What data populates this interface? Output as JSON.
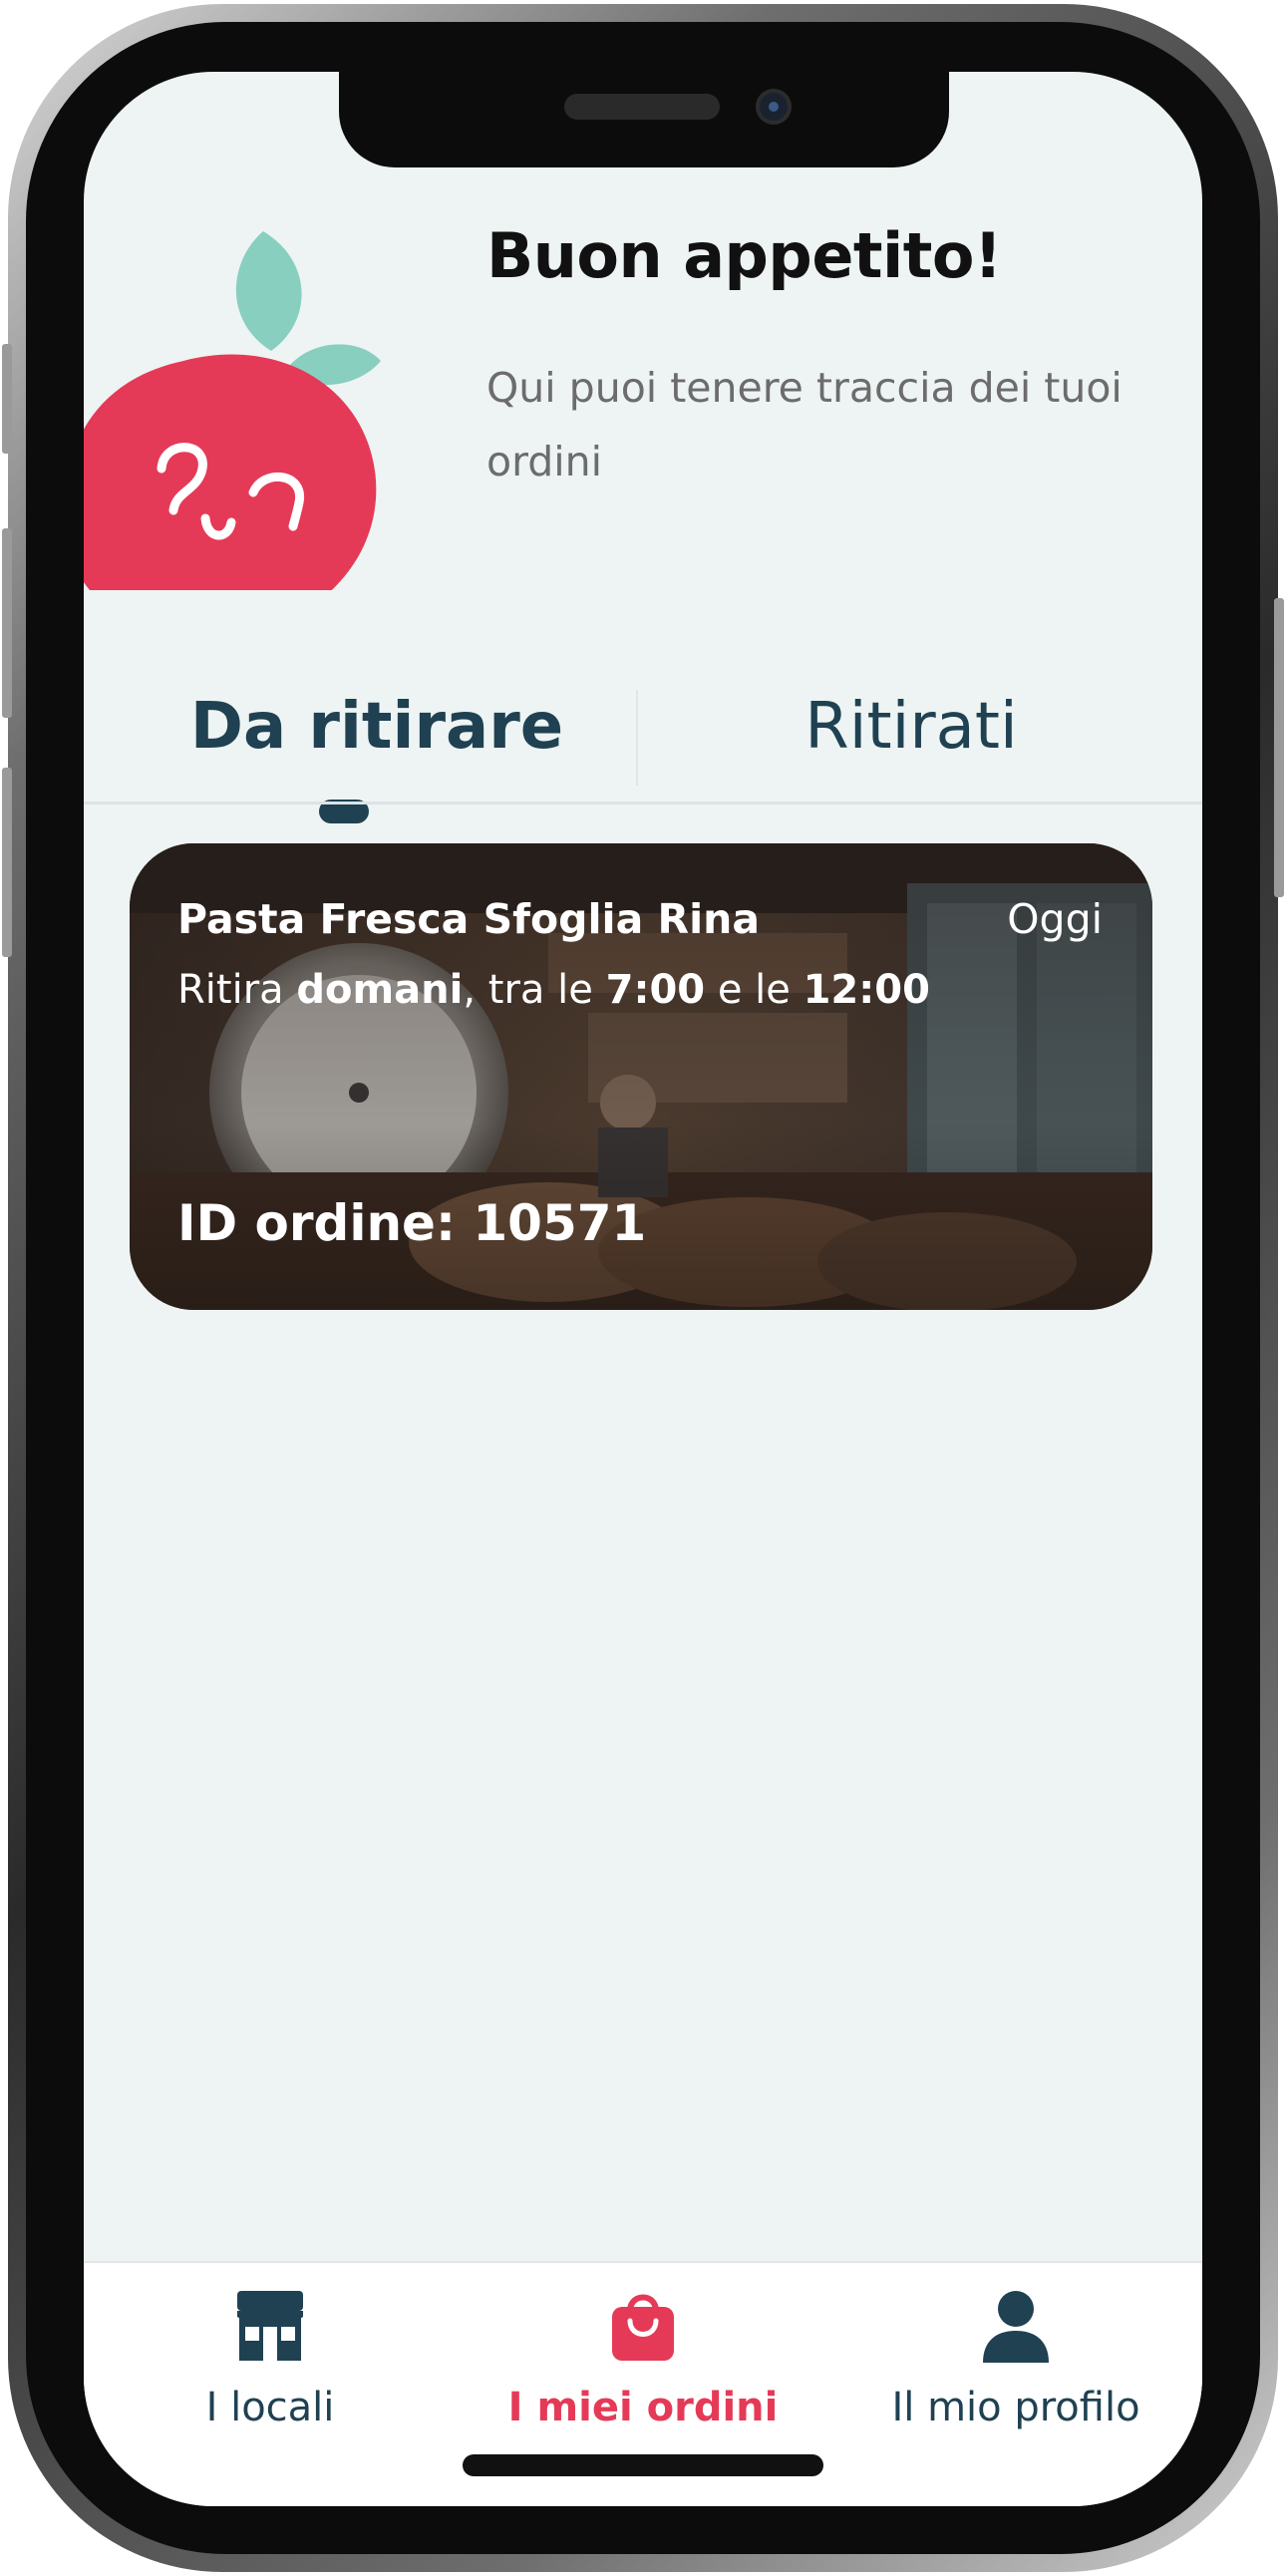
{
  "colors": {
    "background": "#edf4f3",
    "primary_dark": "#1f4152",
    "accent_red": "#e53a57",
    "leaf_green": "#88cfc0",
    "muted_text": "#6c6c6c"
  },
  "header": {
    "title": "Buon appetito!",
    "subtitle": "Qui puoi tenere traccia dei tuoi ordini",
    "mascot_icon": "tomato-mascot-icon"
  },
  "tabs": [
    {
      "label": "Da ritirare",
      "active": true
    },
    {
      "label": "Ritirati",
      "active": false
    }
  ],
  "orders": [
    {
      "shop_name": "Pasta Fresca Sfoglia Rina",
      "date": "Oggi",
      "pickup": {
        "prefix": "Ritira",
        "day": "domani",
        "between": ", tra le",
        "start": "7:00",
        "and": "e le",
        "end": "12:00"
      },
      "order_id": "ID ordine: 10571"
    }
  ],
  "bottom_nav": [
    {
      "label": "I locali",
      "icon": "store-icon",
      "active": false
    },
    {
      "label": "I miei ordini",
      "icon": "shopping-bag-icon",
      "active": true
    },
    {
      "label": "Il mio profilo",
      "icon": "user-icon",
      "active": false
    }
  ]
}
